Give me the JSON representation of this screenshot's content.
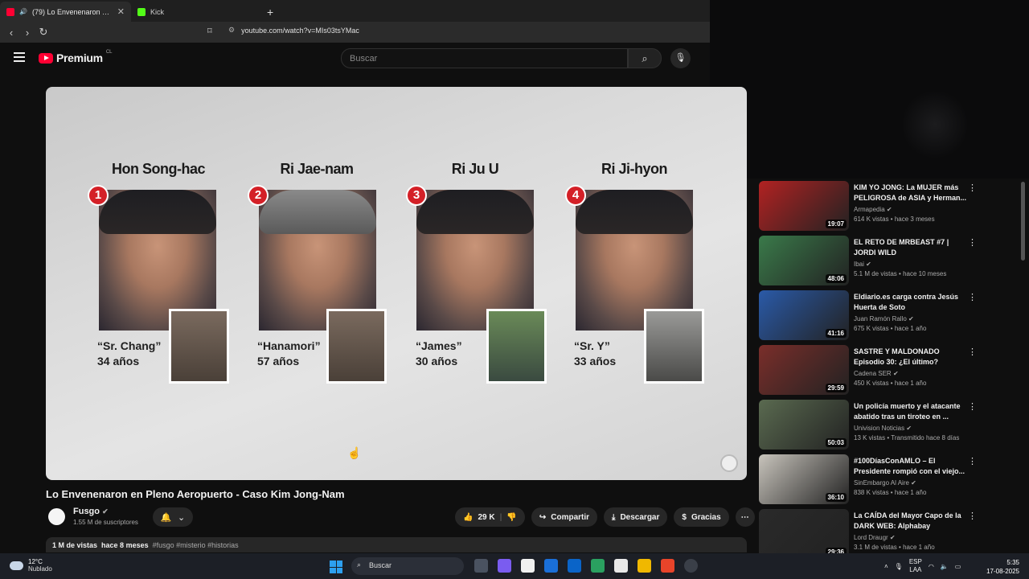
{
  "browser": {
    "tabs": [
      {
        "label": "(79) Lo Envenenaron en Pleno",
        "favicon_color": "#ff0033",
        "close": "✕"
      },
      {
        "label": "Kick",
        "favicon_color": "#53fc18"
      }
    ],
    "new_tab": "+",
    "url": "youtube.com/watch?v=MIs03tsYMac",
    "nav": {
      "back": "‹",
      "forward": "›",
      "reload": "↻"
    }
  },
  "youtube_header": {
    "logo": "Premium",
    "region": "CL",
    "search_placeholder": "Buscar",
    "search_icon": "search-icon",
    "mic_icon": "mic-icon"
  },
  "video_frame": {
    "suspects": [
      {
        "number": "1",
        "name": "Hon Song-hac",
        "alias": "“Sr. Chang”",
        "age": "34 años"
      },
      {
        "number": "2",
        "name": "Ri Jae-nam",
        "alias": "“Hanamori”",
        "age": "57 años"
      },
      {
        "number": "3",
        "name": "Ri Ju U",
        "alias": "“James”",
        "age": "30 años"
      },
      {
        "number": "4",
        "name": "Ri Ji-hyon",
        "alias": "“Sr. Y”",
        "age": "33 años"
      }
    ]
  },
  "video": {
    "title": "Lo Envenenaron en Pleno Aeropuerto - Caso Kim Jong-Nam",
    "channel": "Fusgo",
    "subscribers": "1.55 M de suscriptores",
    "likes": "29 K",
    "share_label": "Compartir",
    "download_label": "Descargar",
    "thanks_label": "Gracias",
    "views": "1 M de vistas",
    "age": "hace 8 meses",
    "tags": "#fusgo #misterio #historias"
  },
  "recommendations": [
    {
      "title": "KIM YO JONG: La MUJER más PELIGROSA de ASIA y Herman...",
      "channel": "Armapedia",
      "views": "614 K vistas",
      "age": "hace 3 meses",
      "duration": "19:07",
      "thumb_color": "#b22222"
    },
    {
      "title": "EL RETO DE MRBEAST #7 | JORDI WILD",
      "channel": "Ibai",
      "views": "5.1 M de vistas",
      "age": "hace 10 meses",
      "duration": "48:06",
      "thumb_color": "#3a7a4a"
    },
    {
      "title": "Eldiario.es carga contra Jesús Huerta de Soto",
      "channel": "Juan Ramón Rallo",
      "views": "675 K vistas",
      "age": "hace 1 año",
      "duration": "41:16",
      "thumb_color": "#2a5aa8"
    },
    {
      "title": "SASTRE Y MALDONADO Episodio 30: ¿El último?",
      "channel": "Cadena SER",
      "views": "450 K vistas",
      "age": "hace 1 año",
      "duration": "29:59",
      "thumb_color": "#7a2e2a"
    },
    {
      "title": "Un policía muerto y el atacante abatido tras un tiroteo en ...",
      "channel": "Univision Noticias",
      "views": "13 K vistas",
      "age": "Transmitido hace 8 días",
      "duration": "50:03",
      "thumb_color": "#5a6a50"
    },
    {
      "title": "#100DíasConAMLO – El Presidente rompió con el viejo...",
      "channel": "SinEmbargo Al Aire",
      "views": "838 K vistas",
      "age": "hace 1 año",
      "duration": "36:10",
      "thumb_color": "#c8c4bc"
    },
    {
      "title": "La CAÍDA del Mayor Capo de la DARK WEB: Alphabay",
      "channel": "Lord Draugr",
      "views": "3.1 M de vistas",
      "age": "hace 1 año",
      "duration": "29:36",
      "thumb_color": "#2a2a2a"
    }
  ],
  "taskbar": {
    "temperature": "12°C",
    "weather": "Nublado",
    "search_label": "Buscar",
    "lang_top": "ESP",
    "lang_bottom": "LAA",
    "time": "5:35",
    "date": "17-08-2025"
  }
}
